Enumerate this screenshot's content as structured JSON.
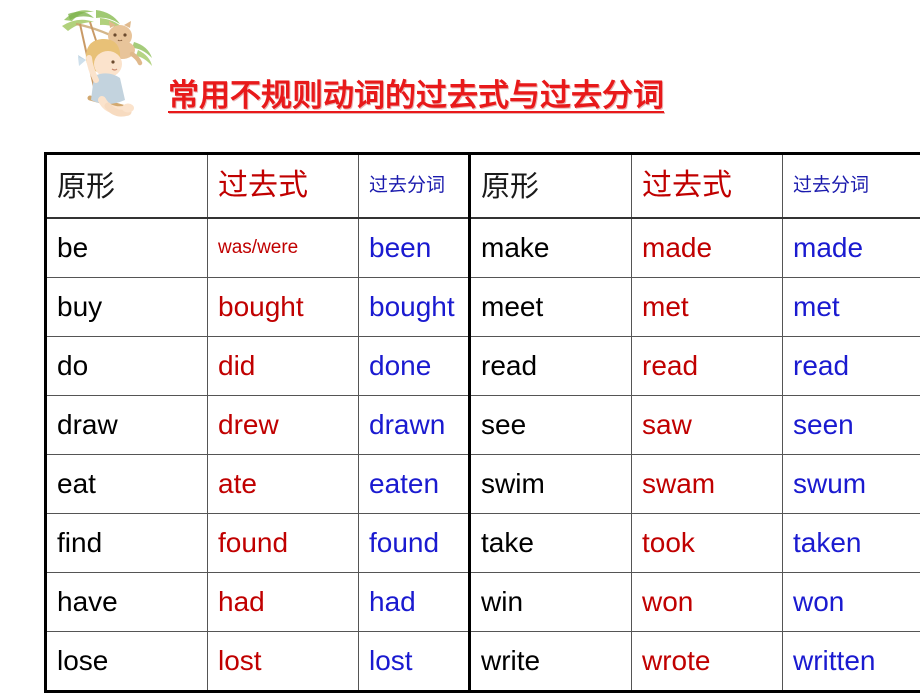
{
  "title": "常用不规则动词的过去式与过去分词",
  "colors": {
    "title_red": "#E8191A",
    "past_red": "#C00000",
    "participle_blue": "#1A1AD0",
    "base_black": "#000000",
    "table_border": "#000000",
    "cell_border": "#555555"
  },
  "illustration": {
    "name": "girl-on-swing-with-cat-illustration",
    "description": "watercolor girl on a rope swing under a tree branch with a cat"
  },
  "tables": [
    {
      "id": "left",
      "headers": {
        "base": "原形",
        "past": "过去式",
        "participle": "过去分词"
      },
      "rows": [
        {
          "base": "be",
          "past": "was/were",
          "past_small": true,
          "participle": "been"
        },
        {
          "base": "buy",
          "past": "bought",
          "past_small": false,
          "participle": "bought"
        },
        {
          "base": "do",
          "past": "did",
          "past_small": false,
          "participle": "done"
        },
        {
          "base": "draw",
          "past": "drew",
          "past_small": false,
          "participle": "drawn"
        },
        {
          "base": "eat",
          "past": "ate",
          "past_small": false,
          "participle": "eaten"
        },
        {
          "base": "find",
          "past": "found",
          "past_small": false,
          "participle": "found"
        },
        {
          "base": "have",
          "past": "had",
          "past_small": false,
          "participle": "had"
        },
        {
          "base": "lose",
          "past": "lost",
          "past_small": false,
          "participle": "lost"
        }
      ]
    },
    {
      "id": "right",
      "headers": {
        "base": "原形",
        "past": "过去式",
        "participle": "过去分词"
      },
      "rows": [
        {
          "base": "make",
          "past": "made",
          "past_small": false,
          "participle": "made"
        },
        {
          "base": "meet",
          "past": "met",
          "past_small": false,
          "participle": "met"
        },
        {
          "base": "read",
          "past": "read",
          "past_small": false,
          "participle": "read"
        },
        {
          "base": "see",
          "past": "saw",
          "past_small": false,
          "participle": "seen"
        },
        {
          "base": "swim",
          "past": "swam",
          "past_small": false,
          "participle": "swum"
        },
        {
          "base": "take",
          "past": "took",
          "past_small": false,
          "participle": "taken"
        },
        {
          "base": "win",
          "past": "won",
          "past_small": false,
          "participle": "won"
        },
        {
          "base": "write",
          "past": "wrote",
          "past_small": false,
          "participle": "written"
        }
      ]
    }
  ]
}
